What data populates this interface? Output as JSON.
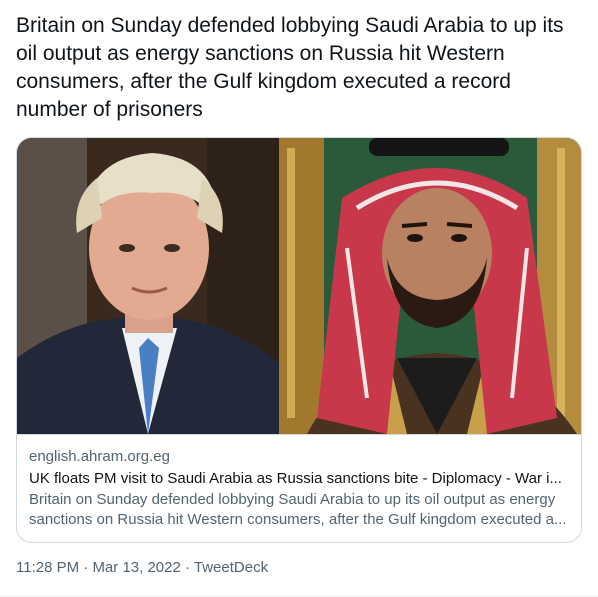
{
  "tweet": {
    "text": "Britain on Sunday defended lobbying Saudi Arabia to up its oil output as energy sanctions on Russia hit Western consumers, after the Gulf kingdom executed a record number of prisoners"
  },
  "card": {
    "domain": "english.ahram.org.eg",
    "title": "UK floats PM visit to Saudi Arabia as Russia sanctions bite - Diplomacy - War i...",
    "description": "Britain on Sunday defended lobbying Saudi Arabia to up its oil output as energy sanctions on Russia hit Western consumers, after the Gulf kingdom executed a..."
  },
  "meta": {
    "time": "11:28 PM",
    "separator1": " · ",
    "date": "Mar 13, 2022",
    "separator2": " · ",
    "source": "TweetDeck"
  },
  "colors": {
    "text_primary": "#0f1419",
    "text_secondary": "#536471",
    "border": "#cfd9de"
  }
}
